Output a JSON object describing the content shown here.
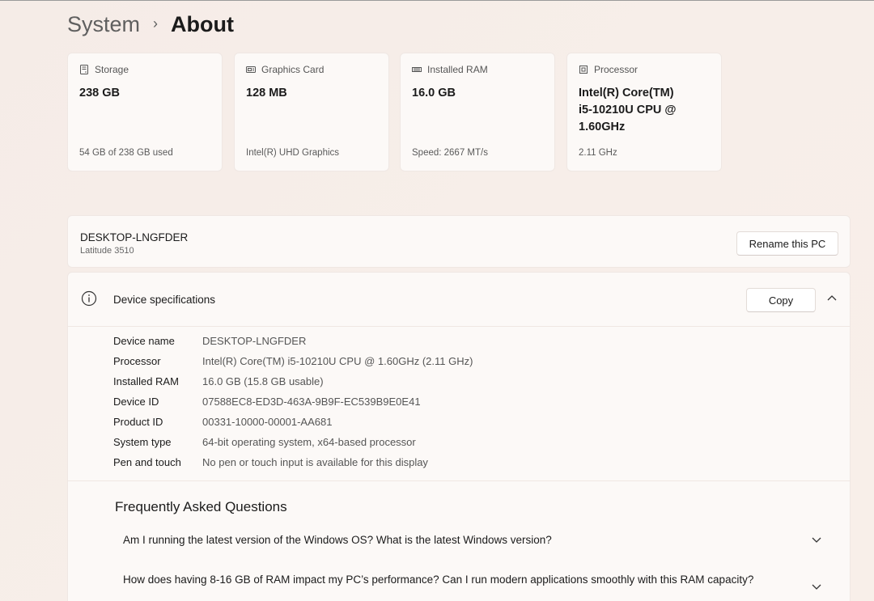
{
  "breadcrumb": {
    "parent": "System",
    "separator": "›",
    "current": "About"
  },
  "cards": [
    {
      "icon": "storage-icon",
      "label": "Storage",
      "value": "238 GB",
      "footer": "54 GB of 238 GB used"
    },
    {
      "icon": "graphics-card-icon",
      "label": "Graphics Card",
      "value": "128 MB",
      "footer": "Intel(R) UHD Graphics"
    },
    {
      "icon": "ram-icon",
      "label": "Installed RAM",
      "value": "16.0 GB",
      "footer": "Speed: 2667 MT/s"
    },
    {
      "icon": "processor-icon",
      "label": "Processor",
      "value_lines": [
        "Intel(R) Core(TM)",
        "i5-10210U CPU @",
        "1.60GHz"
      ],
      "footer": "2.11 GHz"
    }
  ],
  "device": {
    "name": "DESKTOP-LNGFDER",
    "model": "Latitude 3510",
    "rename_label": "Rename this PC"
  },
  "specs": {
    "title": "Device specifications",
    "copy_label": "Copy",
    "rows": [
      {
        "label": "Device name",
        "value": "DESKTOP-LNGFDER"
      },
      {
        "label": "Processor",
        "value": "Intel(R) Core(TM) i5-10210U CPU @ 1.60GHz (2.11 GHz)"
      },
      {
        "label": "Installed RAM",
        "value": "16.0 GB (15.8 GB usable)"
      },
      {
        "label": "Device ID",
        "value": "07588EC8-ED3D-463A-9B9F-EC539B9E0E41"
      },
      {
        "label": "Product ID",
        "value": "00331-10000-00001-AA681"
      },
      {
        "label": "System type",
        "value": "64-bit operating system, x64-based processor"
      },
      {
        "label": "Pen and touch",
        "value": "No pen or touch input is available for this display"
      }
    ]
  },
  "faq": {
    "title": "Frequently Asked Questions",
    "questions": [
      "Am I running the latest version of the Windows OS? What is the latest Windows version?",
      "How does having 8-16 GB of RAM impact my PC’s performance? Can I run modern applications smoothly with this RAM capacity?"
    ]
  },
  "colors": {
    "background": "#f6ede8",
    "card": "#fcf9f7",
    "text": "#1b1b1b"
  }
}
